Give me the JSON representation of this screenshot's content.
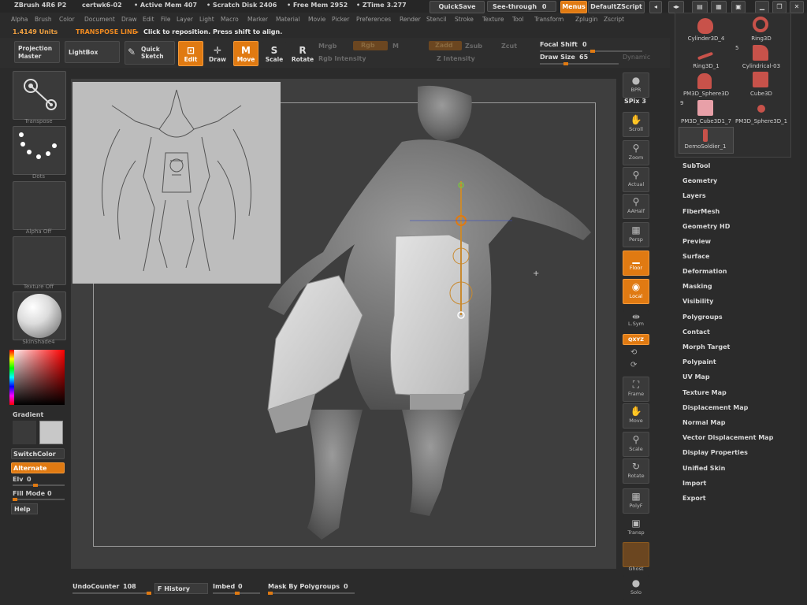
{
  "titlebar": {
    "app": "ZBrush 4R6 P2",
    "doc": "certwk6-02",
    "active_mem": "• Active Mem 407",
    "scratch": "• Scratch Disk 2406",
    "free_mem": "• Free Mem 2952",
    "ztime": "• ZTime 3.277",
    "quicksave": "QuickSave",
    "seethrough": "See-through",
    "seethrough_val": "0",
    "menus": "Menus",
    "script": "DefaultZScript"
  },
  "menubar": [
    "Alpha",
    "Brush",
    "Color",
    "Document",
    "Draw",
    "Edit",
    "File",
    "Layer",
    "Light",
    "Macro",
    "Marker",
    "Material",
    "Movie",
    "Picker",
    "Preferences",
    "Render",
    "Stencil",
    "Stroke",
    "Texture",
    "Tool",
    "Transform",
    "Zplugin",
    "Zscript"
  ],
  "infoline": {
    "units": "1.4149 Units",
    "mode": "TRANSPOSE LINE",
    "hint": "Click to reposition. Press shift to align."
  },
  "toolbar": {
    "projection_master": "Projection Master",
    "lightbox": "LightBox",
    "quick_sketch": "Quick Sketch",
    "edit": "Edit",
    "draw": "Draw",
    "move": "Move",
    "scale": "Scale",
    "rotate": "Rotate",
    "mrgb": "Mrgb",
    "rgb": "Rgb",
    "m": "M",
    "rgb_intensity": "Rgb Intensity",
    "zadd": "Zadd",
    "zsub": "Zsub",
    "zcut": "Zcut",
    "z_intensity": "Z Intensity",
    "focal_shift": "Focal Shift",
    "focal_shift_val": "0",
    "draw_size": "Draw Size",
    "draw_size_val": "65",
    "dynamic": "Dynamic"
  },
  "left": {
    "transpose": "Transpose",
    "dots": "Dots",
    "alpha": "Alpha Off",
    "texture": "Texture Off",
    "material": "SkinShade4",
    "gradient": "Gradient",
    "switchcolor": "SwitchColor",
    "alternate": "Alternate",
    "elv": "Elv",
    "elv_val": "0",
    "fill_mode": "Fill Mode",
    "fill_mode_val": "0",
    "help": "Help"
  },
  "right_shelf": [
    {
      "name": "bpr",
      "label": "BPR"
    },
    {
      "name": "spix",
      "label": "SPix",
      "value": "3"
    },
    {
      "name": "scroll",
      "label": "Scroll"
    },
    {
      "name": "zoom",
      "label": "Zoom"
    },
    {
      "name": "actual",
      "label": "Actual"
    },
    {
      "name": "aahalf",
      "label": "AAHalf"
    },
    {
      "name": "persp",
      "label": "Persp"
    },
    {
      "name": "floor",
      "label": "Floor"
    },
    {
      "name": "local",
      "label": "Local"
    },
    {
      "name": "lsym",
      "label": "L.Sym"
    },
    {
      "name": "xyz",
      "label": "QXYZ"
    },
    {
      "name": "frame",
      "label": "Frame"
    },
    {
      "name": "move",
      "label": "Move"
    },
    {
      "name": "scale",
      "label": "Scale"
    },
    {
      "name": "rotate",
      "label": "Rotate"
    },
    {
      "name": "polyf",
      "label": "PolyF"
    },
    {
      "name": "transp",
      "label": "Transp"
    },
    {
      "name": "ghost",
      "label": "Ghost"
    },
    {
      "name": "solo",
      "label": "Solo"
    }
  ],
  "tools": [
    {
      "label": "Cylinder3D_4"
    },
    {
      "label": "Ring3D"
    },
    {
      "label": "Ring3D_1"
    },
    {
      "label": "Cylindrical-03"
    },
    {
      "label": "PM3D_Sphere3D"
    },
    {
      "label": "Cube3D"
    },
    {
      "label": "PM3D_Cube3D1_7"
    },
    {
      "label": "PM3D_Sphere3D_1"
    },
    {
      "label": "DemoSoldier_1"
    }
  ],
  "tool_counts": {
    "a": "5",
    "b": "9"
  },
  "tool_menu": [
    "SubTool",
    "Geometry",
    "Layers",
    "FiberMesh",
    "Geometry HD",
    "Preview",
    "Surface",
    "Deformation",
    "Masking",
    "Visibility",
    "Polygroups",
    "Contact",
    "Morph Target",
    "Polypaint",
    "UV Map",
    "Texture Map",
    "Displacement Map",
    "Normal Map",
    "Vector Displacement Map",
    "Display Properties",
    "Unified Skin",
    "Import",
    "Export"
  ],
  "bottom": {
    "undo": "UndoCounter",
    "undo_val": "108",
    "history": "F History",
    "imbed": "Imbed",
    "imbed_val": "0",
    "mask_by_poly": "Mask By Polygroups",
    "mask_by_poly_val": "0"
  },
  "colors": {
    "accent": "#e07a12",
    "viewport": "#3e3e3e",
    "panel": "#2b2b2b"
  }
}
